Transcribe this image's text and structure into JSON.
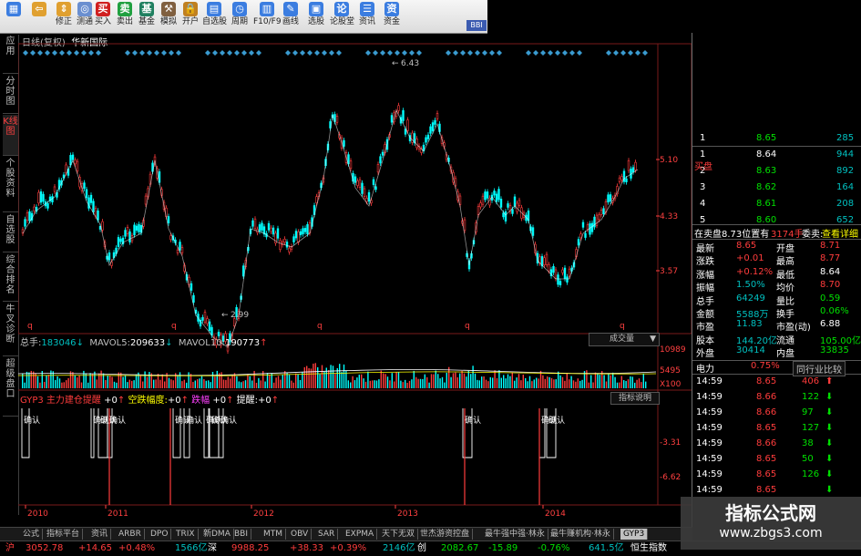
{
  "toolbar": {
    "buttons": [
      {
        "label": "",
        "icon": "home-icon",
        "color": "#3b7de0"
      },
      {
        "label": "",
        "icon": "back-arrow-icon",
        "color": "#e0a030"
      },
      {
        "label": "修正",
        "icon": "up-down-arrow-icon",
        "color": "#e0a030"
      },
      {
        "label": "测通",
        "icon": "ring-icon",
        "color": "#6a8fd0"
      },
      {
        "label": "买入",
        "icon": "buy-icon",
        "color": "#d02020"
      },
      {
        "label": "卖出",
        "icon": "sell-icon",
        "color": "#20a040"
      },
      {
        "label": "基金",
        "icon": "fund-icon",
        "color": "#208060"
      },
      {
        "label": "模拟",
        "icon": "hammer-icon",
        "color": "#806040"
      },
      {
        "label": "开户",
        "icon": "lock-icon",
        "color": "#c08020"
      },
      {
        "label": "自选股",
        "icon": "stock-icon",
        "color": "#3b7de0"
      },
      {
        "label": "周期",
        "icon": "clock-icon",
        "color": "#3b7de0"
      },
      {
        "label": "F10/F9",
        "icon": "f10-icon",
        "color": "#3b7de0"
      },
      {
        "label": "画线",
        "icon": "pen-icon",
        "color": "#3b7de0"
      },
      {
        "label": "选股",
        "icon": "select-icon",
        "color": "#3b7de0"
      },
      {
        "label": "论股堂",
        "icon": "forum-icon",
        "color": "#3b7de0"
      },
      {
        "label": "资讯",
        "icon": "news-icon",
        "color": "#3b7de0"
      },
      {
        "label": "资金",
        "icon": "fund-flow-icon",
        "color": "#3b7de0"
      }
    ],
    "extra_tag": "BBI"
  },
  "left_tabs": [
    "应用",
    "分时图",
    "K线图",
    "个股资料",
    "自选股",
    "综合排名",
    "牛叉诊断",
    "超级盘口"
  ],
  "chart_header": {
    "period": "日线(复权)",
    "name": "华新国际"
  },
  "price_axis": {
    "ticks": [
      "5.10",
      "4.33",
      "3.57"
    ],
    "high_label": "6.43",
    "low_label": "2.99",
    "last_label": "",
    "marker": "q"
  },
  "volume_header": {
    "total_label": "总手:",
    "total": "183046",
    "mavol5_label": "MAVOL5:",
    "mavol5": "209633",
    "mavol10_label": "MAVOL10:",
    "mavol10": "190773",
    "dropdown": "成交量"
  },
  "volume_axis": {
    "ticks": [
      "10989",
      "5495",
      "X100"
    ]
  },
  "indicator_header": {
    "name": "GYP3 主力建仓提醒",
    "v1": "+0",
    "l2": "空跌幅度:",
    "v2": "+0",
    "l3": "跌幅",
    "v3": "+0",
    "l4": "提醒:",
    "v4": "+0",
    "help": "指标说明"
  },
  "indicator_axis": {
    "ticks": [
      "-3.31",
      "-6.62"
    ]
  },
  "indicator_label": "确认",
  "year_axis": [
    "2010",
    "2011",
    "2012",
    "2013",
    "2014"
  ],
  "right_panel": {
    "top_values": [
      "285",
      "944",
      "892",
      "164",
      "208",
      "652"
    ],
    "orders": [
      {
        "label": "1",
        "price": "8.65"
      },
      {
        "label": "1",
        "price": "8.64"
      },
      {
        "label": "2",
        "price": "8.63"
      },
      {
        "label": "3",
        "price": "8.62"
      },
      {
        "label": "4",
        "price": "8.61"
      },
      {
        "label": "5",
        "price": "8.60"
      }
    ],
    "side_label": "买盘",
    "order_info": {
      "left": "在卖盘8.73位置有",
      "mid": "3174手",
      "right": "委卖:",
      "detail": "查看详细"
    },
    "stats": [
      {
        "l": "最新",
        "v": "8.65",
        "l2": "开盘",
        "v2": "8.71"
      },
      {
        "l": "涨跌",
        "v": "+0.01",
        "l2": "最高",
        "v2": "8.77"
      },
      {
        "l": "涨幅",
        "v": "+0.12%",
        "l2": "最低",
        "v2": "8.64"
      },
      {
        "l": "振幅",
        "v": "1.50%",
        "l2": "均价",
        "v2": "8.70"
      },
      {
        "l": "总手",
        "v": "64249",
        "l2": "量比",
        "v2": "0.59"
      },
      {
        "l": "金额",
        "v": "5588万",
        "l2": "换手",
        "v2": "0.06%"
      },
      {
        "l": "市盈",
        "v": "11.83",
        "l2": "市盈(动)",
        "v2": "6.88"
      },
      {
        "l": "股本",
        "v": "144.20亿",
        "l2": "流通",
        "v2": "105.00亿"
      },
      {
        "l": "外盘",
        "v": "30414",
        "l2": "内盘",
        "v2": "33835"
      }
    ],
    "industry": {
      "name": "电力",
      "pct": "0.75%",
      "btn": "同行业比较"
    },
    "ticks": [
      {
        "t": "14:59",
        "p": "8.65",
        "v": "406",
        "dir": "up"
      },
      {
        "t": "14:59",
        "p": "8.66",
        "v": "122",
        "dir": "down"
      },
      {
        "t": "14:59",
        "p": "8.66",
        "v": "97",
        "dir": "down"
      },
      {
        "t": "14:59",
        "p": "8.65",
        "v": "127",
        "dir": "down"
      },
      {
        "t": "14:59",
        "p": "8.66",
        "v": "38",
        "dir": "down"
      },
      {
        "t": "14:59",
        "p": "8.65",
        "v": "50",
        "dir": "down"
      },
      {
        "t": "14:59",
        "p": "8.65",
        "v": "126",
        "dir": "down"
      },
      {
        "t": "14:59",
        "p": "8.65",
        "v": "",
        "dir": "down"
      }
    ]
  },
  "bottom_tabs": [
    "公式",
    "指标平台",
    "资讯",
    "ARBR",
    "DPO",
    "TRIX",
    "新DMA",
    "BBI",
    "MTM",
    "OBV",
    "SAR",
    "EXPMA",
    "天下无双",
    "世杰游资控盘",
    "最牛强中强·林永",
    "最牛赚机构·林永",
    "GYP3"
  ],
  "status_bar": {
    "sh_label": "沪",
    "sh_index": "3052.78",
    "sh_chg": "+14.65",
    "sh_pct": "+0.48%",
    "sh_amt": "1566亿",
    "sz_label": "深",
    "sz_index": "9988.25",
    "sz_chg": "+38.33",
    "sz_pct": "+0.39%",
    "sz_amt": "2146亿",
    "cy_label": "创",
    "cy_index": "2082.67",
    "cy_chg": "-15.89",
    "cy_pct": "-0.76%",
    "cy_amt": "641.5亿",
    "hs_label": "恒生指数"
  },
  "watermark": {
    "title": "指标公式网",
    "url": "www.zbgs3.com"
  },
  "colors": {
    "up": "#ff3c3c",
    "down": "#00ffff",
    "text": "#c0c0c0",
    "axis": "#ff4040"
  }
}
